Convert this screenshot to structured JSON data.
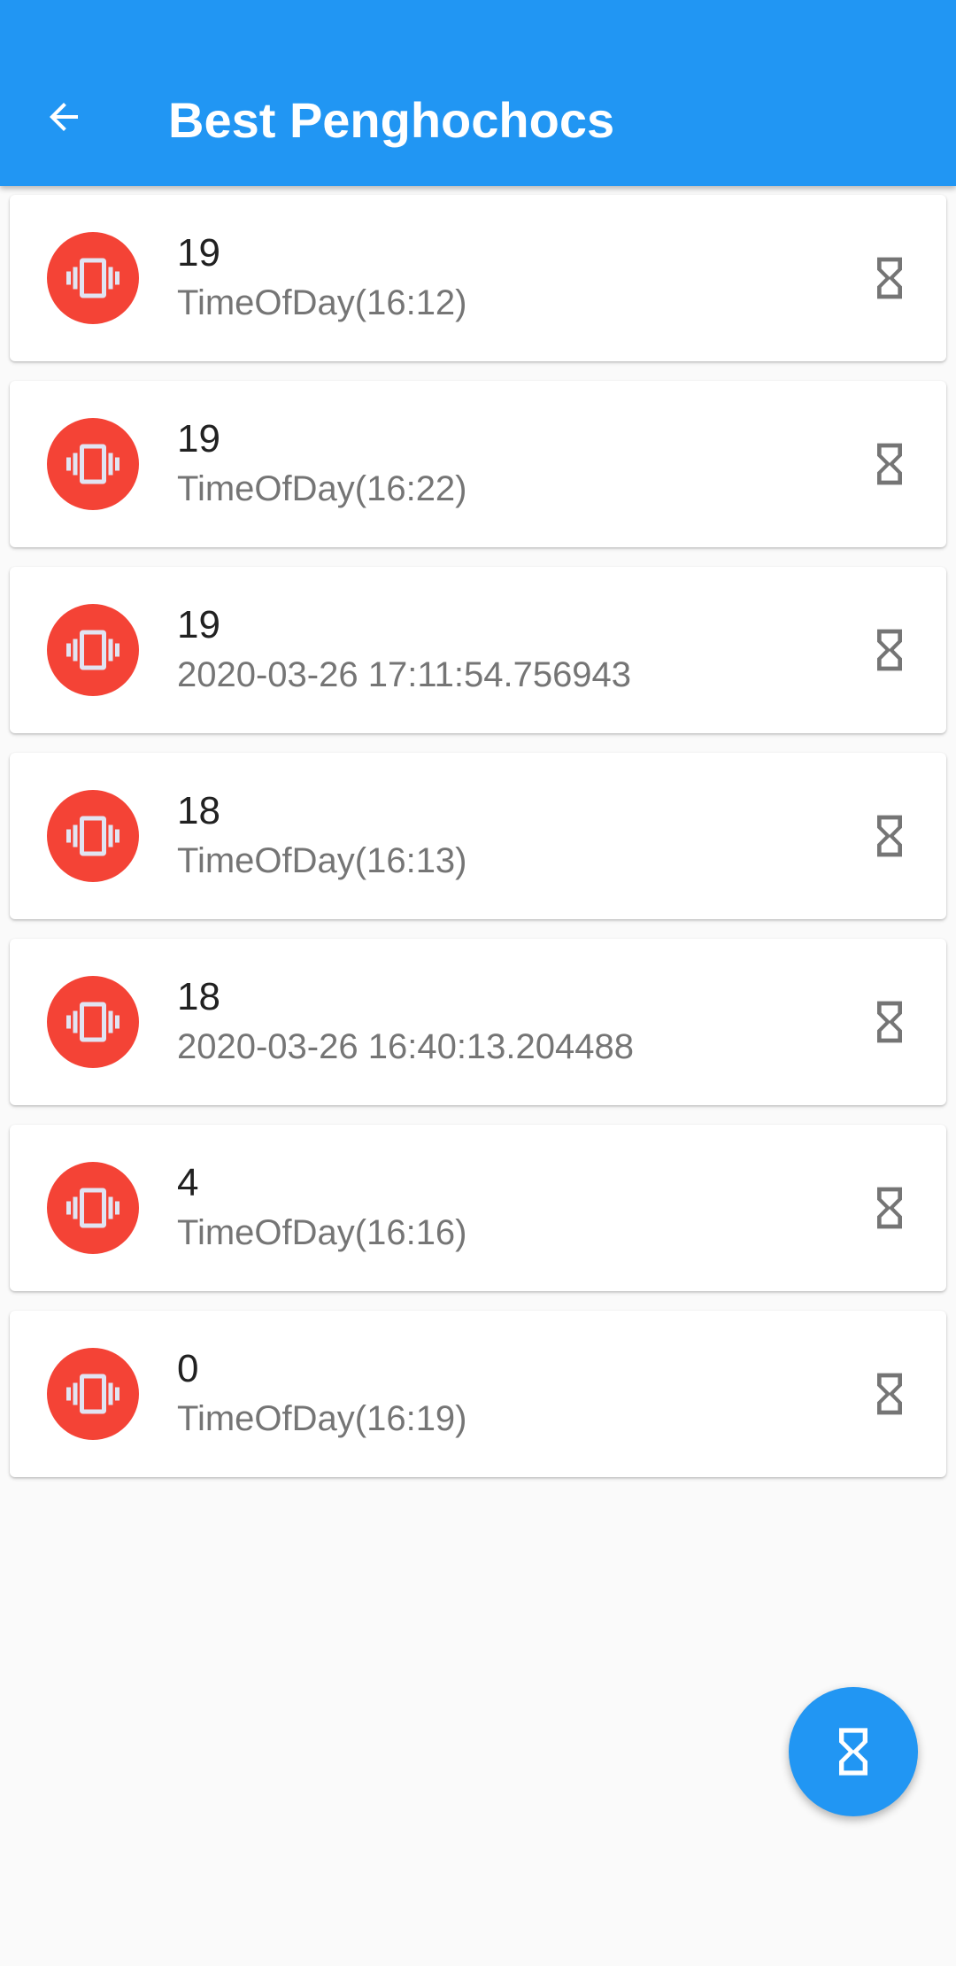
{
  "appbar": {
    "title": "Best Penghochocs",
    "back_icon": "arrow-back-icon",
    "background": "#2196f3"
  },
  "colors": {
    "avatar": "#f44336",
    "trailing_icon": "#757575",
    "fab": "#2196f3"
  },
  "items": [
    {
      "title": "19",
      "subtitle": "TimeOfDay(16:12)"
    },
    {
      "title": "19",
      "subtitle": "TimeOfDay(16:22)"
    },
    {
      "title": "19",
      "subtitle": "2020-03-26 17:11:54.756943"
    },
    {
      "title": "18",
      "subtitle": "TimeOfDay(16:13)"
    },
    {
      "title": "18",
      "subtitle": "2020-03-26 16:40:13.204488"
    },
    {
      "title": "4",
      "subtitle": "TimeOfDay(16:16)"
    },
    {
      "title": "0",
      "subtitle": "TimeOfDay(16:19)"
    }
  ],
  "item_icons": {
    "leading": "vibration-icon",
    "trailing": "hourglass-icon"
  },
  "fab": {
    "icon": "hourglass-icon"
  }
}
